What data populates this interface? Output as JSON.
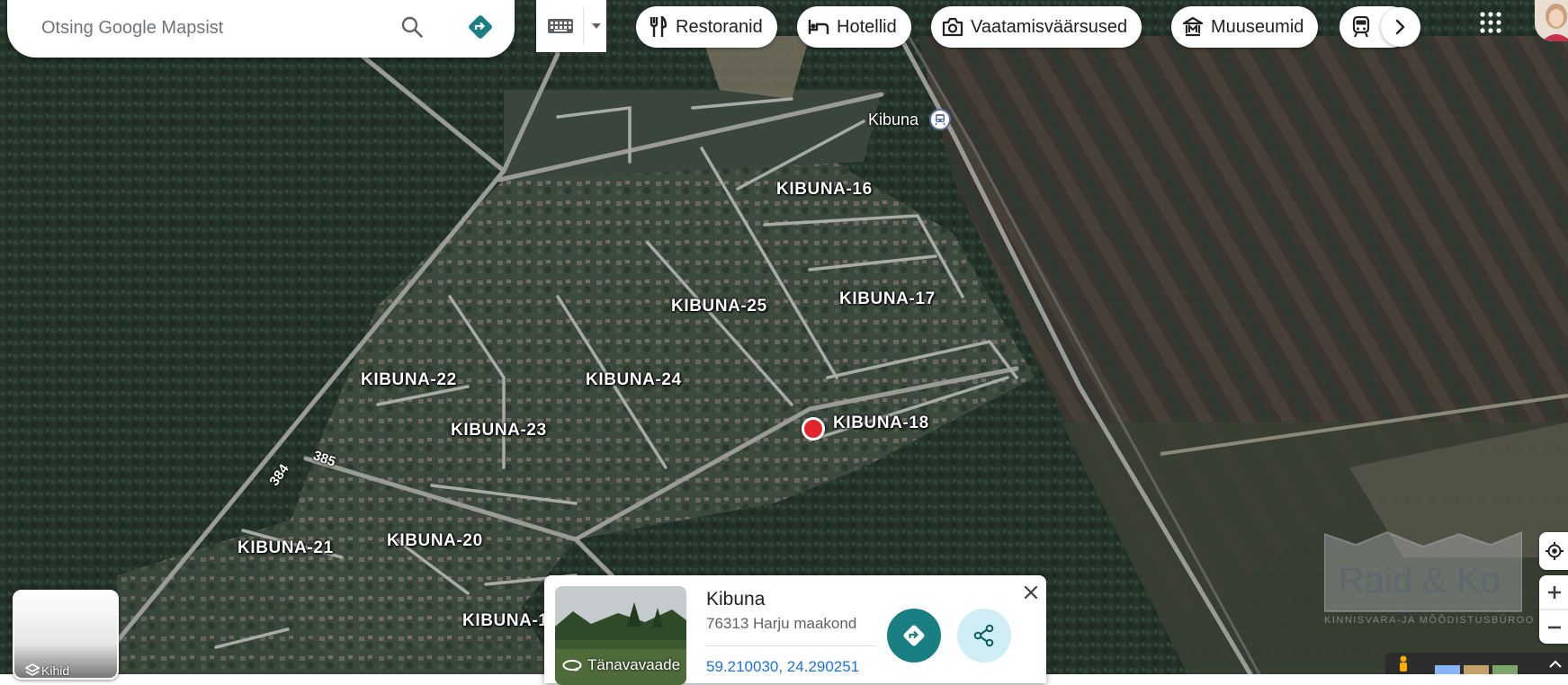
{
  "search": {
    "placeholder": "Otsing Google Mapsist"
  },
  "chips": {
    "restaurants": "Restoranid",
    "hotels": "Hotellid",
    "attractions": "Vaatamisväärsused",
    "museums": "Muuseumid"
  },
  "map": {
    "station_label": "Kibuna",
    "area_labels": {
      "kibuna_16": "KIBUNA-16",
      "kibuna_17": "KIBUNA-17",
      "kibuna_25": "KIBUNA-25",
      "kibuna_22": "KIBUNA-22",
      "kibuna_24": "KIBUNA-24",
      "kibuna_18": "KIBUNA-18",
      "kibuna_23": "KIBUNA-23",
      "kibuna_21": "KIBUNA-21",
      "kibuna_20": "KIBUNA-20",
      "kibuna_partial": "KIBUNA-1"
    },
    "road_numbers": {
      "r384": "384",
      "r385": "385"
    }
  },
  "card": {
    "title": "Kibuna",
    "address": "76313 Harju maakond",
    "coordinates": "59.210030, 24.290251",
    "streetview_label": "Tänavavaade"
  },
  "layers": {
    "label": "Kihid"
  },
  "watermark": {
    "text": "Raid & Ko",
    "sub": "KINNISVARA-JA MÕÕDISTUSBÜROO"
  },
  "colors": {
    "accent_teal": "#1a7f83",
    "share_bg": "#cfeef5",
    "link_blue": "#1a73e8",
    "pin_red": "#e3262e"
  }
}
